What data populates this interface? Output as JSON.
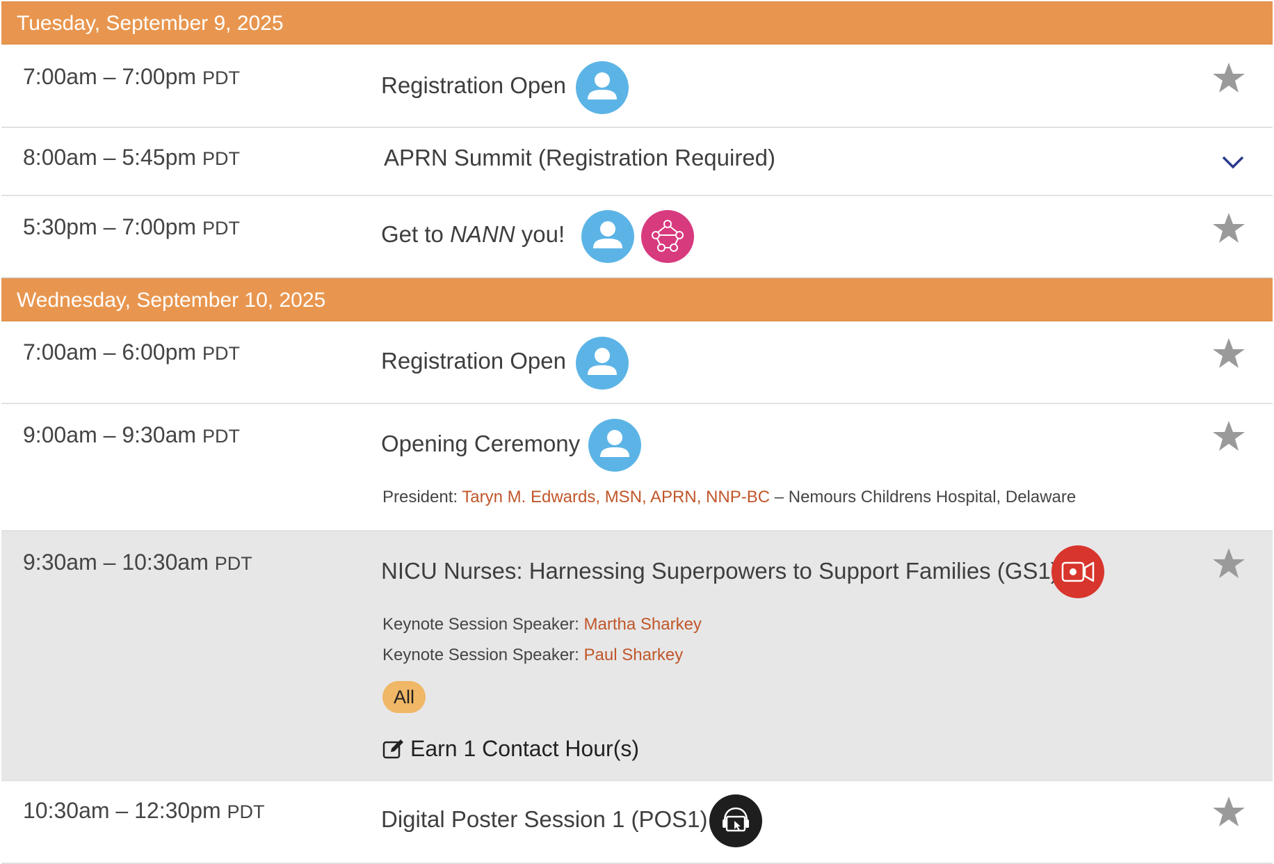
{
  "days": [
    {
      "label": "Tuesday, September 9, 2025"
    },
    {
      "label": "Wednesday, September 10, 2025"
    }
  ],
  "sessions": [
    {
      "start_end": "7:00am – 7:00pm",
      "tz": "PDT",
      "title": "Registration Open",
      "icons": [
        "person-icon"
      ]
    },
    {
      "start_end": "8:00am – 5:45pm",
      "tz": "PDT",
      "title": "APRN Summit (Registration Required)",
      "icons": [],
      "expand": "chevron-down-icon"
    },
    {
      "start_end": "5:30pm – 7:00pm",
      "tz": "PDT",
      "title_before": "Get to ",
      "title_em": "NANN",
      "title_after": " you!",
      "icons": [
        "person-icon",
        "network-icon"
      ]
    },
    {
      "start_end": "7:00am – 6:00pm",
      "tz": "PDT",
      "title": "Registration Open",
      "icons": [
        "person-icon"
      ]
    },
    {
      "start_end": "9:00am – 9:30am",
      "tz": "PDT",
      "title": "Opening Ceremony",
      "icons": [
        "person-icon"
      ],
      "speakers": [
        {
          "role": "President:",
          "name": "Taryn M. Edwards, MSN, APRN, NNP-BC",
          "affiliation": " – Nemours Childrens Hospital, Delaware"
        }
      ]
    },
    {
      "start_end": "9:30am – 10:30am",
      "tz": "PDT",
      "title": "NICU Nurses: Harnessing Superpowers to Support Families (GS1)",
      "icons": [
        "video-camera-icon"
      ],
      "speakers": [
        {
          "role": "Keynote Session Speaker:",
          "name": "Martha Sharkey"
        },
        {
          "role": "Keynote Session Speaker:",
          "name": "Paul Sharkey"
        }
      ],
      "badge": "All",
      "contact_hours": "Earn 1 Contact Hour(s)"
    },
    {
      "start_end": "10:30am – 12:30pm",
      "tz": "PDT",
      "title": "Digital Poster Session 1 (POS1)",
      "icons": [
        "digital-poster-icon"
      ]
    }
  ],
  "colors": {
    "day_header": "#e8964f",
    "link": "#c0562a",
    "person_icon": "#5cb4e6",
    "network_icon": "#d83a7e",
    "video_icon": "#d8352d",
    "badge": "#f0b766",
    "star": "#9a9a9a",
    "chevron": "#2b3a8c"
  }
}
